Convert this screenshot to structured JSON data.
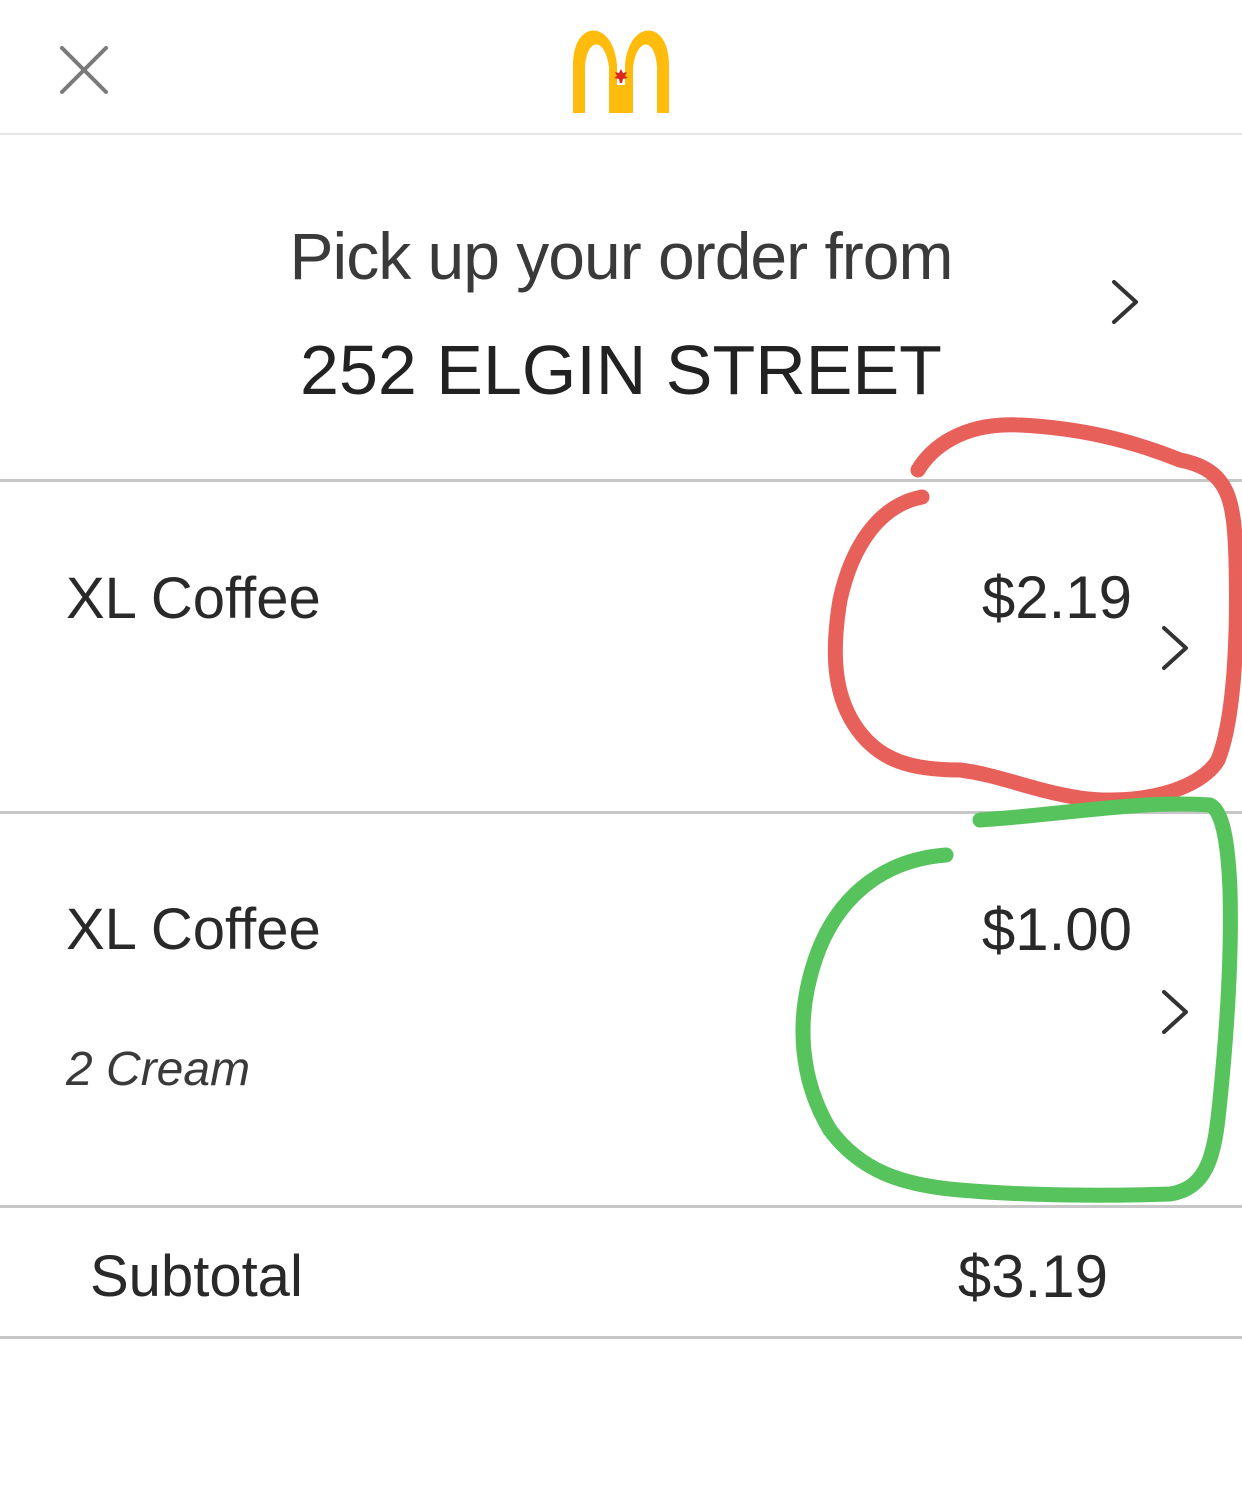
{
  "header": {
    "close_icon": "close-icon",
    "logo_icon": "golden-arches-logo",
    "brand_color": "#FFBC0D",
    "leaf_color": "#DA291C"
  },
  "pickup": {
    "label": "Pick up your order from",
    "address": "252 ELGIN STREET",
    "chevron_icon": "chevron-right-icon"
  },
  "order": {
    "items": [
      {
        "name": "XL Coffee",
        "price": "$2.19",
        "options": "",
        "chevron_icon": "chevron-right-icon",
        "annotation_color": "#E8605A"
      },
      {
        "name": "XL Coffee",
        "price": "$1.00",
        "options": "2 Cream",
        "chevron_icon": "chevron-right-icon",
        "annotation_color": "#57C35D"
      }
    ],
    "subtotal_label": "Subtotal",
    "subtotal_value": "$3.19"
  }
}
